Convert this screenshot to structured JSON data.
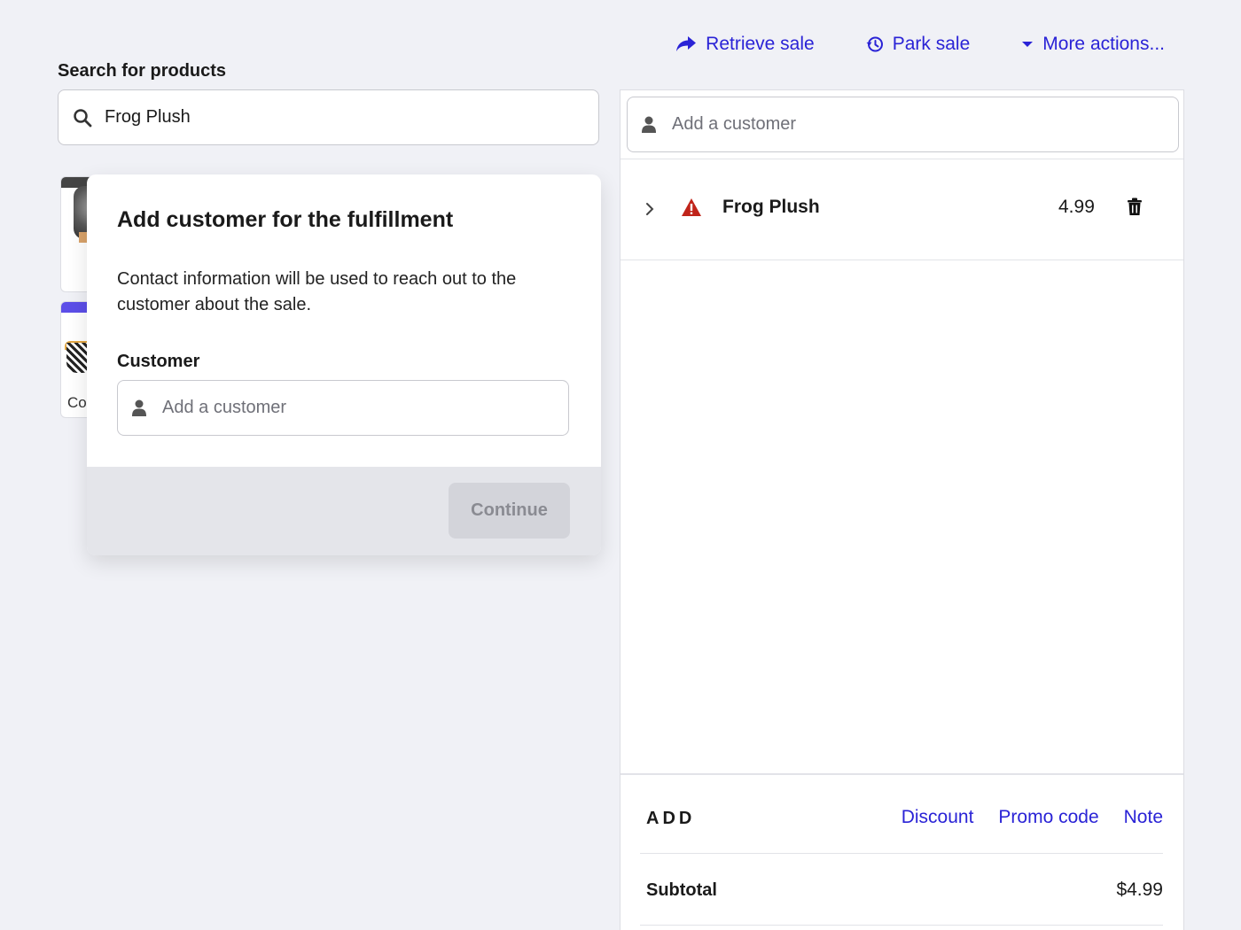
{
  "header": {
    "actions": [
      {
        "label": "Retrieve sale",
        "icon": "share-arrow-icon"
      },
      {
        "label": "Park sale",
        "icon": "history-icon"
      },
      {
        "label": "More actions...",
        "icon": "caret-down-icon"
      }
    ]
  },
  "search": {
    "label": "Search for products",
    "value": "Frog Plush"
  },
  "products": [
    {
      "name_visible": "Co",
      "accent_color": "#5c4ee8"
    }
  ],
  "modal": {
    "title": "Add customer for the fulfillment",
    "description": "Contact information will be used to reach out to the customer about the sale.",
    "field_label": "Customer",
    "field_placeholder": "Add a customer",
    "continue_label": "Continue"
  },
  "cart": {
    "customer_placeholder": "Add a customer",
    "items": [
      {
        "name": "Frog Plush",
        "price": "4.99",
        "warning": true
      }
    ],
    "add_title": "ADD",
    "add_links": [
      "Discount",
      "Promo code",
      "Note"
    ],
    "subtotal_label": "Subtotal",
    "subtotal_value": "$4.99"
  },
  "colors": {
    "accent": "#2a23d6",
    "warning": "#c0241a",
    "background": "#f0f1f6"
  }
}
